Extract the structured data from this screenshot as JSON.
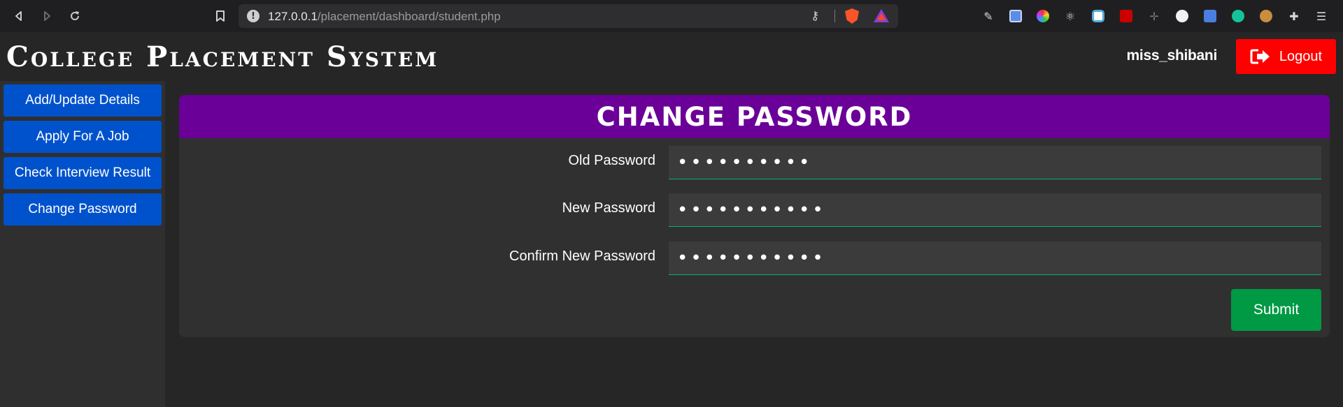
{
  "browser": {
    "url_host": "127.0.0.1",
    "url_path": "/placement/dashboard/student.php"
  },
  "app": {
    "brand": "College Placement System",
    "username": "miss_shibani",
    "logout_label": "Logout"
  },
  "sidebar": {
    "items": [
      {
        "label": "Add/Update Details"
      },
      {
        "label": "Apply For A Job"
      },
      {
        "label": "Check Interview Result"
      },
      {
        "label": "Change Password"
      }
    ]
  },
  "form": {
    "title": "CHANGE PASSWORD",
    "fields": [
      {
        "label": "Old Password",
        "value": "••••••••••"
      },
      {
        "label": "New Password",
        "value": "•••••••••••"
      },
      {
        "label": "Confirm New Password",
        "value": "•••••••••••"
      }
    ],
    "submit_label": "Submit"
  },
  "colors": {
    "header_purple": "#6a0097",
    "sidebar_button": "#0052cc",
    "logout_red": "#ff0000",
    "submit_green": "#009944"
  }
}
